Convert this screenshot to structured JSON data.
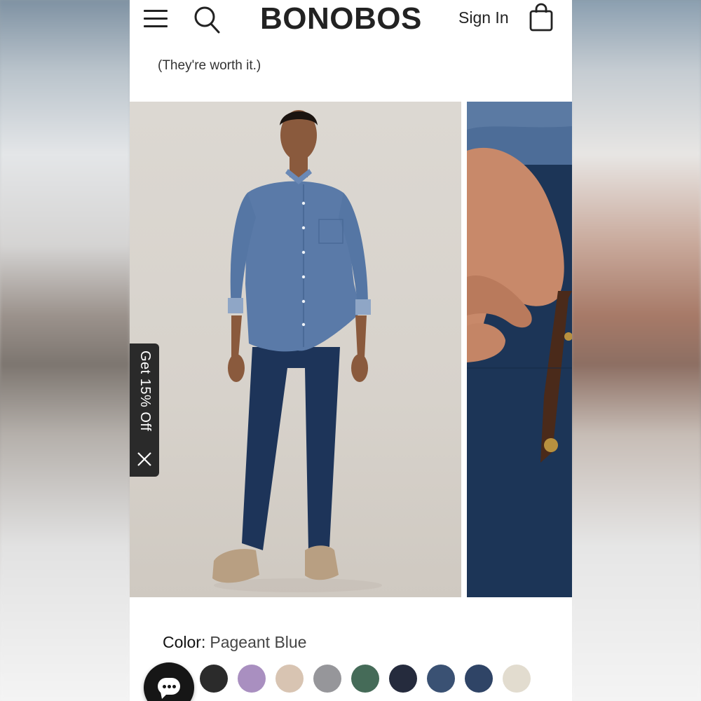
{
  "header": {
    "logo": "BONOBOS",
    "sign_in_label": "Sign In",
    "icons": [
      "menu-icon",
      "search-icon",
      "shopping-bag-icon"
    ]
  },
  "tagline": "(They're worth it.)",
  "gallery": {
    "images": [
      {
        "description_icon": "product-photo-main"
      },
      {
        "description_icon": "product-photo-detail"
      }
    ]
  },
  "promo": {
    "label": "Get 15% Off",
    "close_icon": "close-icon"
  },
  "color": {
    "label": "Color:",
    "value": "Pageant Blue",
    "swatches": [
      {
        "name": "charcoal",
        "hex": "#2b2b2b"
      },
      {
        "name": "lavender",
        "hex": "#a98fc0"
      },
      {
        "name": "tan",
        "hex": "#d8c4b2"
      },
      {
        "name": "gray",
        "hex": "#96969a"
      },
      {
        "name": "green",
        "hex": "#456b58"
      },
      {
        "name": "navy",
        "hex": "#252b3d"
      },
      {
        "name": "slate-blue",
        "hex": "#3a5173"
      },
      {
        "name": "pageant-blue",
        "hex": "#2f4466"
      },
      {
        "name": "stone",
        "hex": "#e2dccf"
      }
    ]
  },
  "chat": {
    "icon": "chat-icon"
  }
}
